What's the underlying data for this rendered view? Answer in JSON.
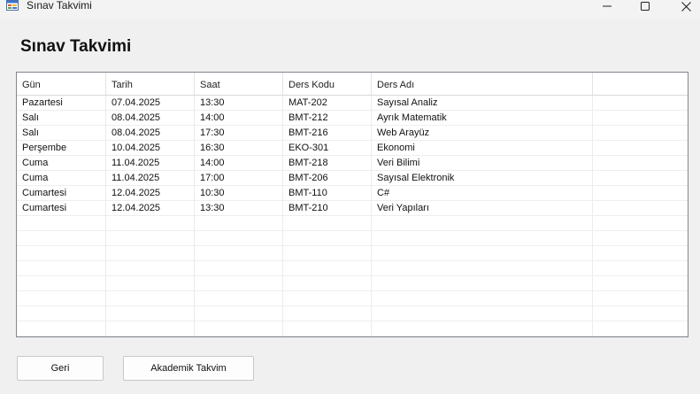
{
  "window": {
    "title": "Sınav Takvimi"
  },
  "heading": "Sınav Takvimi",
  "table": {
    "columns": [
      "Gün",
      "Tarih",
      "Saat",
      "Ders Kodu",
      "Ders Adı"
    ],
    "rows": [
      [
        "Pazartesi",
        "07.04.2025",
        "13:30",
        "MAT-202",
        "Sayısal Analiz"
      ],
      [
        "Salı",
        "08.04.2025",
        "14:00",
        "BMT-212",
        "Ayrık Matematik"
      ],
      [
        "Salı",
        "08.04.2025",
        "17:30",
        "BMT-216",
        "Web Arayüz"
      ],
      [
        "Perşembe",
        "10.04.2025",
        "16:30",
        "EKO-301",
        "Ekonomi"
      ],
      [
        "Cuma",
        "11.04.2025",
        "14:00",
        "BMT-218",
        "Veri Bilimi"
      ],
      [
        "Cuma",
        "11.04.2025",
        "17:00",
        "BMT-206",
        "Sayısal Elektronik"
      ],
      [
        "Cumartesi",
        "12.04.2025",
        "10:30",
        "BMT-110",
        "C#"
      ],
      [
        "Cumartesi",
        "12.04.2025",
        "13:30",
        "BMT-210",
        "Veri Yapıları"
      ]
    ]
  },
  "buttons": {
    "back": "Geri",
    "academic_calendar": "Akademik Takvim"
  },
  "icons": {
    "app": "window-form-icon",
    "minimize": "minimize-icon",
    "maximize": "maximize-icon",
    "close": "close-icon"
  }
}
